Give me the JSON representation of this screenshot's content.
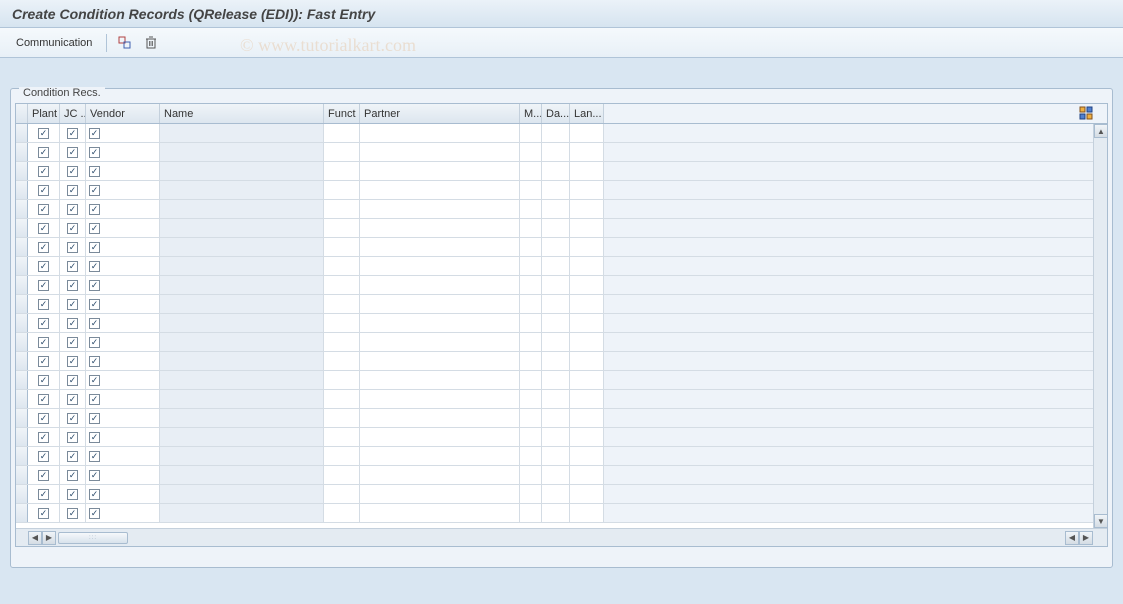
{
  "title": "Create Condition Records (QRelease (EDI)): Fast Entry",
  "toolbar": {
    "communication": "Communication"
  },
  "watermark": "© www.tutorialkart.com",
  "panel": {
    "title": "Condition Recs."
  },
  "columns": {
    "plant": "Plant",
    "jc": "JC ...",
    "vendor": "Vendor",
    "name": "Name",
    "funct": "Funct",
    "partner": "Partner",
    "m": "M...",
    "da": "Da...",
    "lan": "Lan..."
  },
  "rows": [
    {
      "plant": true,
      "jc": true,
      "vendor": true,
      "name": "",
      "funct": "",
      "partner": "",
      "m": "",
      "da": "",
      "lan": ""
    },
    {
      "plant": true,
      "jc": true,
      "vendor": true,
      "name": "",
      "funct": "",
      "partner": "",
      "m": "",
      "da": "",
      "lan": ""
    },
    {
      "plant": true,
      "jc": true,
      "vendor": true,
      "name": "",
      "funct": "",
      "partner": "",
      "m": "",
      "da": "",
      "lan": ""
    },
    {
      "plant": true,
      "jc": true,
      "vendor": true,
      "name": "",
      "funct": "",
      "partner": "",
      "m": "",
      "da": "",
      "lan": ""
    },
    {
      "plant": true,
      "jc": true,
      "vendor": true,
      "name": "",
      "funct": "",
      "partner": "",
      "m": "",
      "da": "",
      "lan": ""
    },
    {
      "plant": true,
      "jc": true,
      "vendor": true,
      "name": "",
      "funct": "",
      "partner": "",
      "m": "",
      "da": "",
      "lan": ""
    },
    {
      "plant": true,
      "jc": true,
      "vendor": true,
      "name": "",
      "funct": "",
      "partner": "",
      "m": "",
      "da": "",
      "lan": ""
    },
    {
      "plant": true,
      "jc": true,
      "vendor": true,
      "name": "",
      "funct": "",
      "partner": "",
      "m": "",
      "da": "",
      "lan": ""
    },
    {
      "plant": true,
      "jc": true,
      "vendor": true,
      "name": "",
      "funct": "",
      "partner": "",
      "m": "",
      "da": "",
      "lan": ""
    },
    {
      "plant": true,
      "jc": true,
      "vendor": true,
      "name": "",
      "funct": "",
      "partner": "",
      "m": "",
      "da": "",
      "lan": ""
    },
    {
      "plant": true,
      "jc": true,
      "vendor": true,
      "name": "",
      "funct": "",
      "partner": "",
      "m": "",
      "da": "",
      "lan": ""
    },
    {
      "plant": true,
      "jc": true,
      "vendor": true,
      "name": "",
      "funct": "",
      "partner": "",
      "m": "",
      "da": "",
      "lan": ""
    },
    {
      "plant": true,
      "jc": true,
      "vendor": true,
      "name": "",
      "funct": "",
      "partner": "",
      "m": "",
      "da": "",
      "lan": ""
    },
    {
      "plant": true,
      "jc": true,
      "vendor": true,
      "name": "",
      "funct": "",
      "partner": "",
      "m": "",
      "da": "",
      "lan": ""
    },
    {
      "plant": true,
      "jc": true,
      "vendor": true,
      "name": "",
      "funct": "",
      "partner": "",
      "m": "",
      "da": "",
      "lan": ""
    },
    {
      "plant": true,
      "jc": true,
      "vendor": true,
      "name": "",
      "funct": "",
      "partner": "",
      "m": "",
      "da": "",
      "lan": ""
    },
    {
      "plant": true,
      "jc": true,
      "vendor": true,
      "name": "",
      "funct": "",
      "partner": "",
      "m": "",
      "da": "",
      "lan": ""
    },
    {
      "plant": true,
      "jc": true,
      "vendor": true,
      "name": "",
      "funct": "",
      "partner": "",
      "m": "",
      "da": "",
      "lan": ""
    },
    {
      "plant": true,
      "jc": true,
      "vendor": true,
      "name": "",
      "funct": "",
      "partner": "",
      "m": "",
      "da": "",
      "lan": ""
    },
    {
      "plant": true,
      "jc": true,
      "vendor": true,
      "name": "",
      "funct": "",
      "partner": "",
      "m": "",
      "da": "",
      "lan": ""
    },
    {
      "plant": true,
      "jc": true,
      "vendor": true,
      "name": "",
      "funct": "",
      "partner": "",
      "m": "",
      "da": "",
      "lan": ""
    }
  ]
}
